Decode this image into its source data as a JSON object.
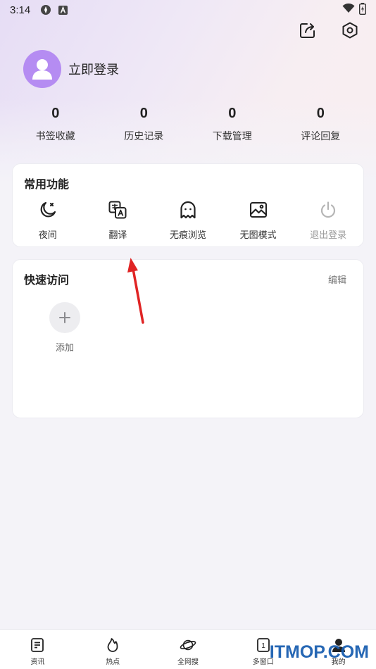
{
  "status_bar": {
    "time": "3:14",
    "icons": [
      "settings-gear-icon",
      "font-a-icon",
      "wifi-icon",
      "battery-icon"
    ]
  },
  "header": {
    "icons": [
      "share-icon",
      "settings-icon"
    ]
  },
  "profile": {
    "login_label": "立即登录",
    "avatar_color": "#b58cf2"
  },
  "stats": [
    {
      "value": "0",
      "label": "书签收藏"
    },
    {
      "value": "0",
      "label": "历史记录"
    },
    {
      "value": "0",
      "label": "下载管理"
    },
    {
      "value": "0",
      "label": "评论回复"
    }
  ],
  "common_functions": {
    "title": "常用功能",
    "items": [
      {
        "label": "夜间",
        "icon": "moon-icon"
      },
      {
        "label": "翻译",
        "icon": "translate-icon"
      },
      {
        "label": "无痕浏览",
        "icon": "ghost-icon"
      },
      {
        "label": "无图模式",
        "icon": "image-icon"
      },
      {
        "label": "退出登录",
        "icon": "power-icon"
      }
    ]
  },
  "quick_access": {
    "title": "快速访问",
    "edit_label": "编辑",
    "add_label": "添加"
  },
  "annotation": {
    "arrow_color": "#e02424"
  },
  "tabbar": [
    {
      "label": "资讯",
      "icon": "news-icon"
    },
    {
      "label": "热点",
      "icon": "flame-icon"
    },
    {
      "label": "全网搜",
      "icon": "planet-icon"
    },
    {
      "label": "多窗口",
      "icon": "windows-icon",
      "badge": "1"
    },
    {
      "label": "我的",
      "icon": "profile-icon"
    }
  ],
  "watermark": "ITMOP.COM"
}
